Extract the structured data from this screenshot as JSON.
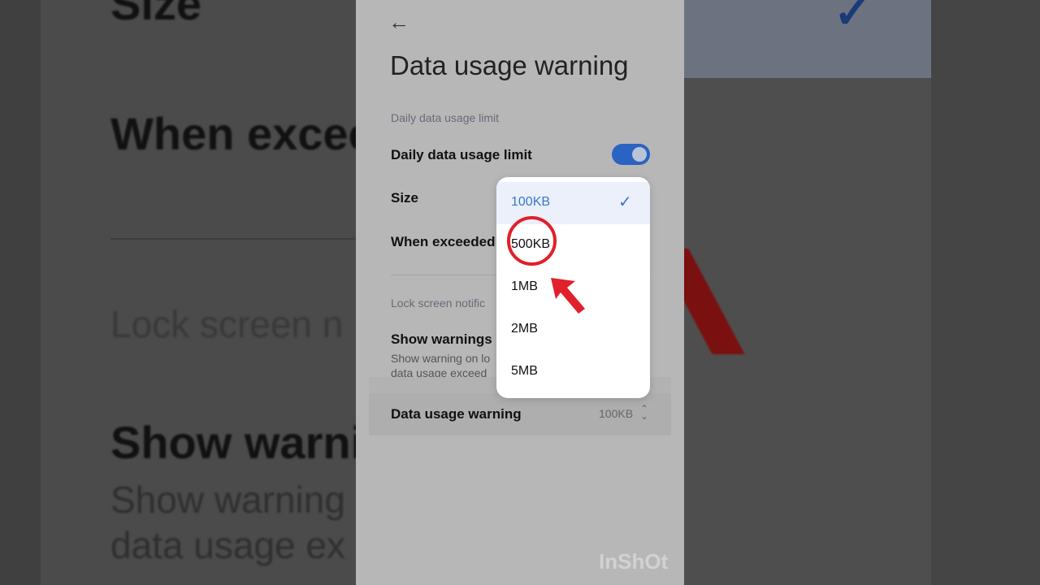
{
  "background": {
    "left_texts": [
      "Size",
      "When exceed",
      "Lock screen n",
      "Show warni",
      "Show warning",
      "data usage ex"
    ]
  },
  "header": {
    "title": "Data usage warning"
  },
  "sections": {
    "daily": "Daily data usage limit",
    "lock": "Lock screen notific"
  },
  "rows": {
    "daily_limit": "Daily data usage limit",
    "size": "Size",
    "when_exceeded": "When exceeded",
    "show_warnings": "Show warnings",
    "show_warnings_sub": "Show warning on lo data usage exceed",
    "data_usage_warning": "Data usage warning",
    "data_usage_warning_value": "100KB"
  },
  "toggle": {
    "on": true,
    "color": "#2b63c2"
  },
  "dropdown": {
    "options": [
      "100KB",
      "500KB",
      "1MB",
      "2MB",
      "5MB"
    ],
    "selected": "100KB"
  },
  "annotation": {
    "highlight_color": "#e0202a",
    "target": "500KB"
  },
  "watermark": "InShOt"
}
